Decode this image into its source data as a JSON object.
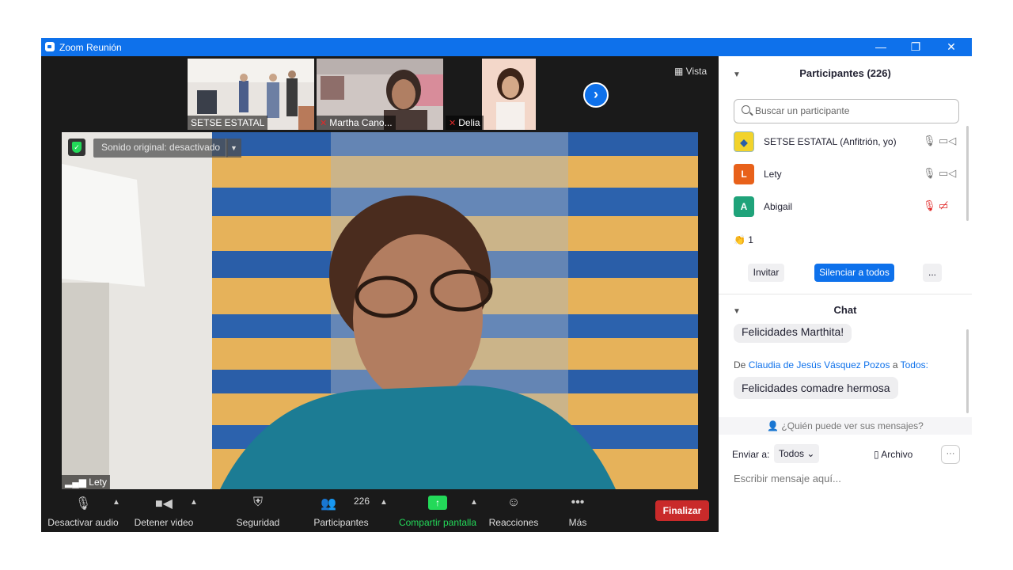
{
  "window": {
    "title": "Zoom Reunión",
    "minimize": "—",
    "restore": "❐",
    "close": "✕"
  },
  "top_strip": {
    "thumbnails": [
      {
        "name": "SETSE ESTATAL",
        "muted": false
      },
      {
        "name": "Martha Cano...",
        "muted": true
      },
      {
        "name": "Delia",
        "muted": true
      }
    ],
    "next_arrow": "›",
    "view_label": "Vista"
  },
  "main_video": {
    "sound_label": "Sonido original: desactivado",
    "speaker_name": "Lety"
  },
  "toolbar": {
    "mute_label": "Desactivar audio",
    "video_label": "Detener video",
    "security_label": "Seguridad",
    "participants_label": "Participantes",
    "participants_count": "226",
    "share_label": "Compartir pantalla",
    "reactions_label": "Reacciones",
    "more_label": "Más",
    "end_label": "Finalizar"
  },
  "participants_panel": {
    "title": "Participantes (226)",
    "search_placeholder": "Buscar un participante",
    "participants": [
      {
        "name": "SETSE ESTATAL (Anfitrión, yo)",
        "initial": "",
        "avatar_color": "#f2d32b",
        "muted": false,
        "video_off": false
      },
      {
        "name": "Lety",
        "initial": "L",
        "avatar_color": "#e8611a",
        "muted": false,
        "video_off": false
      },
      {
        "name": "Abigail",
        "initial": "A",
        "avatar_color": "#1fa37a",
        "muted": true,
        "video_off": true
      }
    ],
    "reaction_count": "1",
    "invite_label": "Invitar",
    "mute_all_label": "Silenciar a todos",
    "more_label": "..."
  },
  "chat_panel": {
    "title": "Chat",
    "prev_message": "Felicidades Marthita!",
    "from_prefix": "De",
    "sender": "Claudia de Jesús Vásquez Pozos",
    "to_word": "a",
    "recipient": "Todos:",
    "message": "Felicidades comadre hermosa",
    "privacy_text": "¿Quién puede ver sus mensajes?",
    "send_to_label": "Enviar a:",
    "send_to_value": "Todos",
    "file_label": "Archivo",
    "more_label": "···",
    "input_placeholder": "Escribir mensaje aquí..."
  },
  "colors": {
    "accent": "#0e71eb",
    "end_red": "#c92a2a",
    "share_green": "#23d959"
  }
}
